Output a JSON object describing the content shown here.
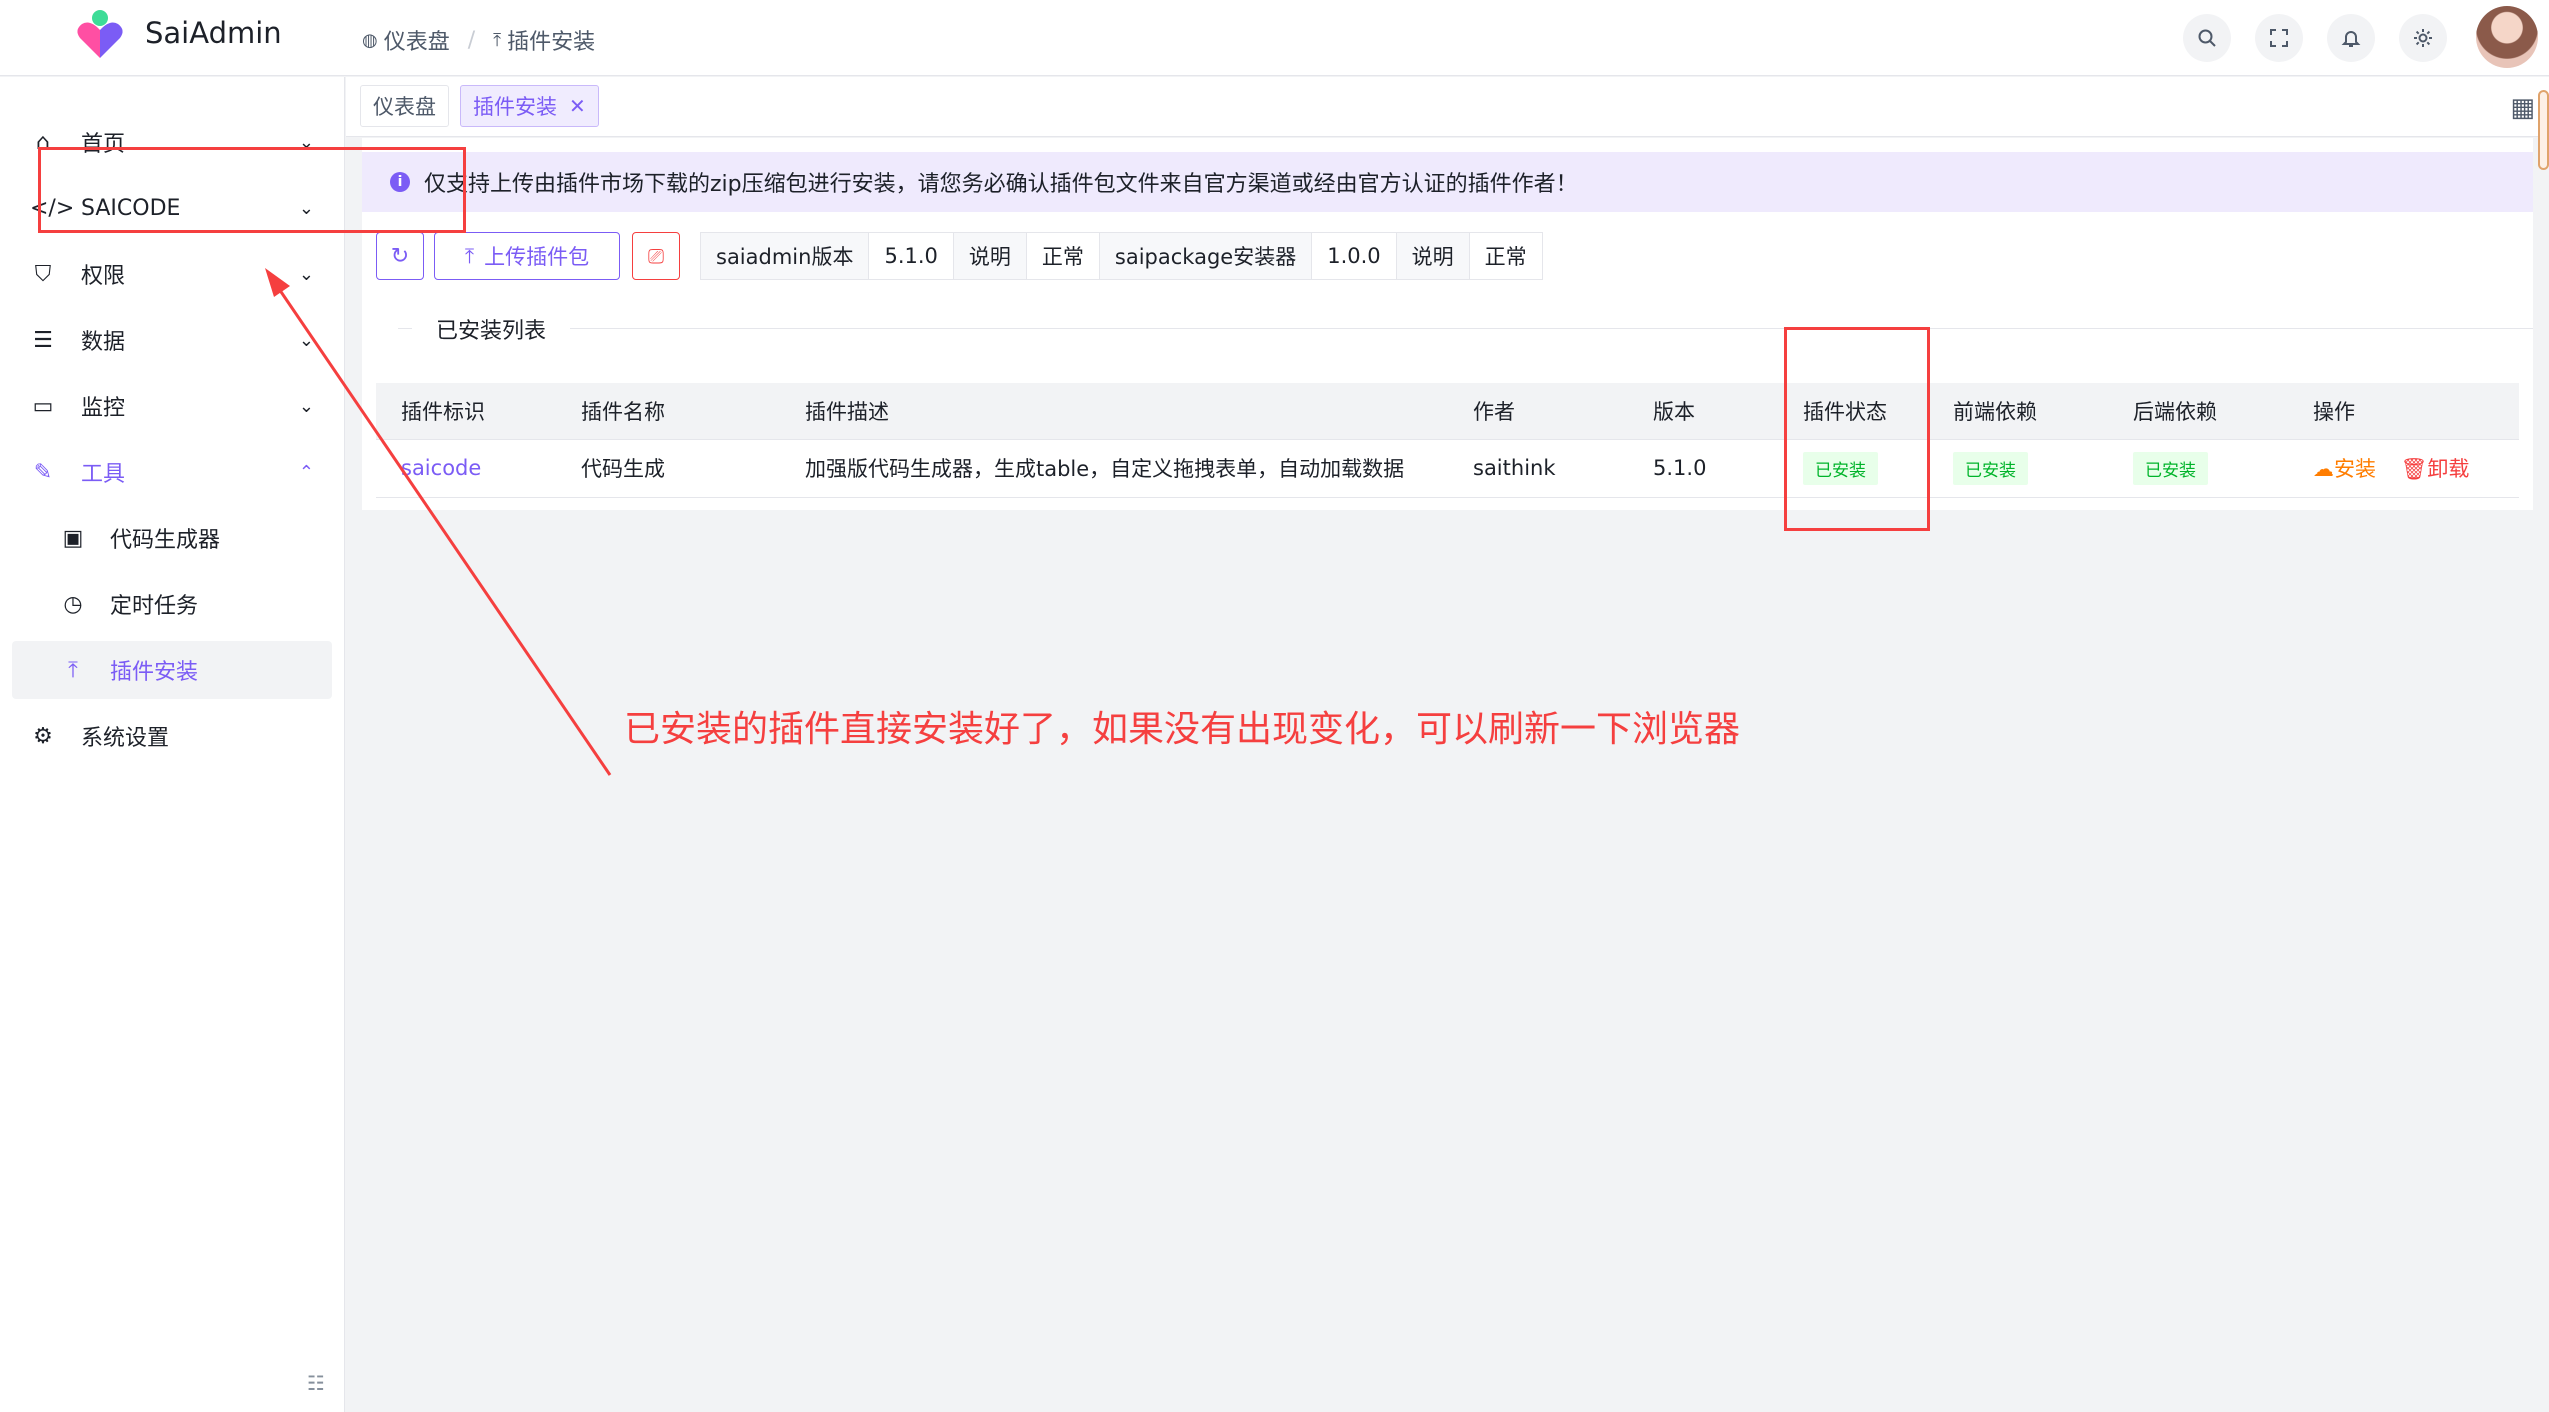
{
  "app": {
    "title": "SaiAdmin"
  },
  "breadcrumb": [
    {
      "label": "仪表盘",
      "icon": "dashboard-icon"
    },
    {
      "label": "插件安装",
      "icon": "upload-icon"
    }
  ],
  "header_actions": [
    "search-icon",
    "fullscreen-icon",
    "bell-icon",
    "gear-icon"
  ],
  "sidebar": {
    "items": [
      {
        "label": "首页",
        "icon": "home-icon"
      },
      {
        "label": "SAICODE",
        "icon": "code-icon"
      },
      {
        "label": "权限",
        "icon": "shield-icon"
      },
      {
        "label": "数据",
        "icon": "database-icon"
      },
      {
        "label": "监控",
        "icon": "monitor-icon"
      },
      {
        "label": "工具",
        "icon": "wrench-icon"
      },
      {
        "label": "代码生成器",
        "icon": "code-file-icon"
      },
      {
        "label": "定时任务",
        "icon": "clock-icon"
      },
      {
        "label": "插件安装",
        "icon": "upload-icon"
      },
      {
        "label": "系统设置",
        "icon": "settings-icon"
      }
    ]
  },
  "tabs": [
    {
      "label": "仪表盘"
    },
    {
      "label": "插件安装",
      "active": true
    }
  ],
  "alert": {
    "text": "仅支持上传由插件市场下载的zip压缩包进行安装，请您务必确认插件包文件来自官方渠道或经由官方认证的插件作者！"
  },
  "toolbar": {
    "upload_label": "上传插件包",
    "info": [
      "saiadmin版本",
      "5.1.0",
      "说明",
      "正常",
      "saipackage安装器",
      "1.0.0",
      "说明",
      "正常"
    ]
  },
  "section": {
    "title": "已安装列表"
  },
  "table": {
    "headers": [
      "插件标识",
      "插件名称",
      "插件描述",
      "作者",
      "版本",
      "插件状态",
      "前端依赖",
      "后端依赖",
      "操作"
    ],
    "rows": [
      {
        "id": "saicode",
        "name": "代码生成",
        "desc": "加强版代码生成器，生成table，自定义拖拽表单，自动加载数据",
        "author": "saithink",
        "version": "5.1.0",
        "status": "已安装",
        "frontend": "已安装",
        "backend": "已安装",
        "install": "安装",
        "uninstall": "卸载"
      }
    ]
  },
  "annotation": {
    "text": "已安装的插件直接安装好了，如果没有出现变化，可以刷新一下浏览器"
  },
  "colors": {
    "accent": "#7b5cf5",
    "success": "#00b42a",
    "danger": "#f53f3f",
    "warning": "#ff7d00"
  }
}
